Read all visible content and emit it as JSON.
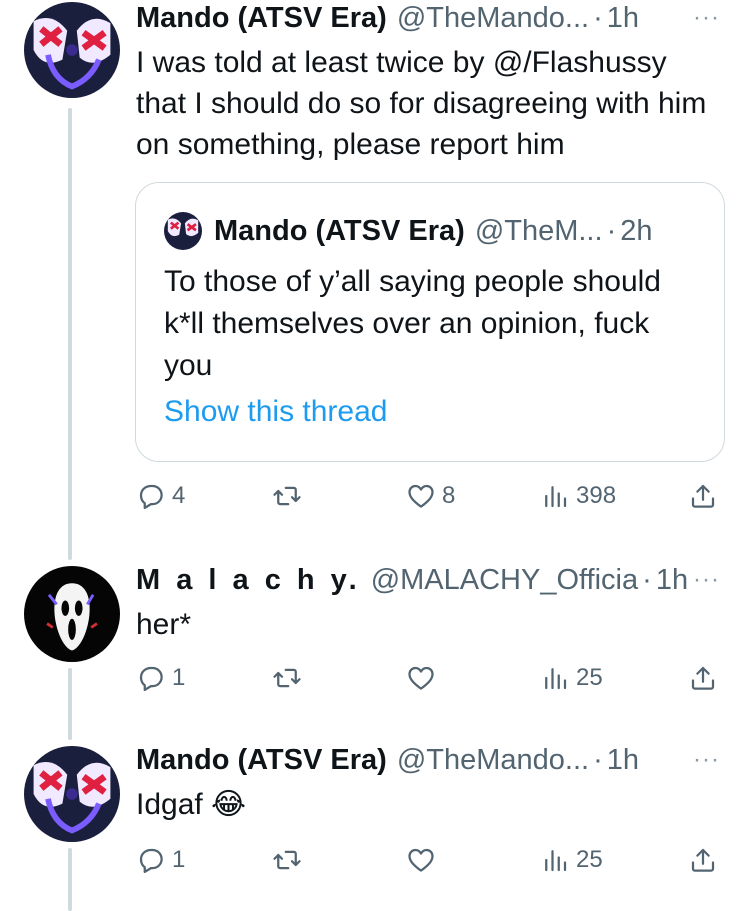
{
  "tweets": [
    {
      "name": "Mando (ATSV Era)",
      "handle": "@TheMando...",
      "dot": "·",
      "time": "1h",
      "text": "I was told at least twice by @/Flashussy that I should do so for disagreeing with him on something, please report him",
      "quote": {
        "name": "Mando (ATSV Era)",
        "handle": "@TheM...",
        "dot": "·",
        "time": "2h",
        "text": "To those of y’all saying people should k*ll themselves over an opinion, fuck you",
        "link": "Show this thread"
      },
      "replies": "4",
      "retweets": "",
      "likes": "8",
      "views": "398"
    },
    {
      "name": "M a l a c h y.",
      "handle": "@MALACHY_Officia",
      "dot": "·",
      "time": "1h",
      "text": "her*",
      "replies": "1",
      "retweets": "",
      "likes": "",
      "views": "25"
    },
    {
      "name": "Mando (ATSV Era)",
      "handle": "@TheMando...",
      "dot": "·",
      "time": "1h",
      "text": "Idgaf 😂",
      "replies": "1",
      "retweets": "",
      "likes": "",
      "views": "25"
    }
  ],
  "more_label": "···",
  "icons": [
    "reply-icon",
    "retweet-icon",
    "like-icon",
    "views-icon",
    "share-icon",
    "more-icon"
  ],
  "colors": {
    "link": "#1d9bf0",
    "secondary": "#536471",
    "border": "#cfd9de"
  }
}
